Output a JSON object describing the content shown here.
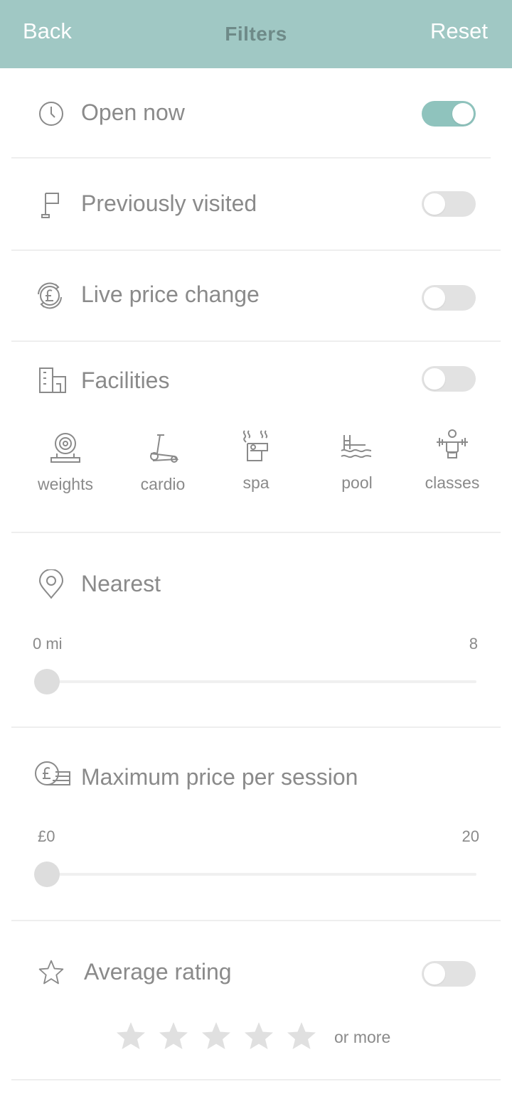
{
  "header": {
    "back_label": "Back",
    "title": "Filters",
    "reset_label": "Reset"
  },
  "toggles": {
    "open_now": {
      "label": "Open now",
      "on": true,
      "icon": "clock-icon"
    },
    "previously_visited": {
      "label": "Previously visited",
      "on": false,
      "icon": "flag-icon"
    },
    "live_price_change": {
      "label": "Live price change",
      "on": false,
      "icon": "price-change-icon"
    },
    "facilities": {
      "label": "Facilities",
      "on": false,
      "icon": "building-icon"
    },
    "average_rating": {
      "label": "Average rating",
      "on": false,
      "icon": "star-outline-icon"
    }
  },
  "facilities": [
    {
      "label": "weights",
      "icon": "weights-icon"
    },
    {
      "label": "cardio",
      "icon": "cardio-icon"
    },
    {
      "label": "spa",
      "icon": "spa-icon"
    },
    {
      "label": "pool",
      "icon": "pool-icon"
    },
    {
      "label": "classes",
      "icon": "classes-icon"
    }
  ],
  "nearest": {
    "label": "Nearest",
    "icon": "location-pin-icon",
    "min_label": "0 mi",
    "max_label": "8",
    "value_fraction": 0
  },
  "max_price": {
    "label": "Maximum price per session",
    "icon": "pound-coins-icon",
    "min_label": "£0",
    "max_label": "20",
    "value_fraction": 0
  },
  "rating": {
    "stars": 5,
    "selected": 0,
    "suffix": "or more"
  },
  "colors": {
    "header_bg": "#a0c8c4",
    "toggle_on": "#8fc3bd",
    "toggle_off": "#e2e2e2",
    "text": "#8a8a8a",
    "star_off": "#e0e0e0"
  }
}
